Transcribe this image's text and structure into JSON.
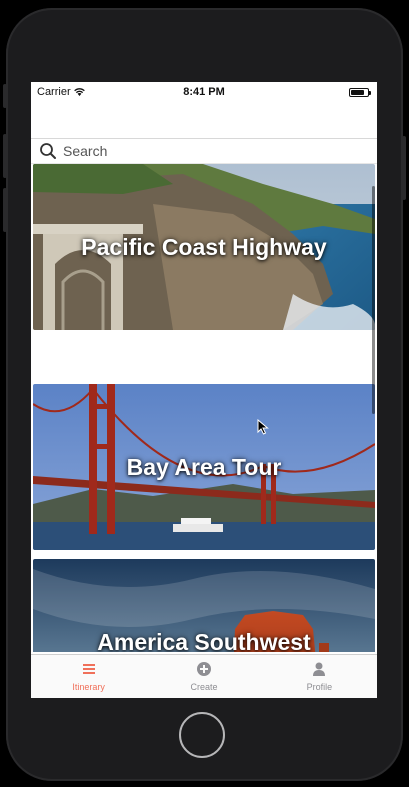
{
  "status_bar": {
    "carrier": "Carrier",
    "time": "8:41 PM",
    "battery_level": 0.8
  },
  "search": {
    "placeholder": "Search",
    "icon": "search-icon"
  },
  "cards": [
    {
      "title": "Pacific Coast Highway",
      "image": "coastal-bridge-photo"
    },
    {
      "title": "Bay Area Tour",
      "image": "golden-gate-bridge-photo"
    },
    {
      "title": "America Southwest",
      "image": "desert-butte-photo"
    }
  ],
  "tabs": [
    {
      "label": "Itinerary",
      "icon": "list-icon",
      "active": true
    },
    {
      "label": "Create",
      "icon": "plus-circle-icon",
      "active": false
    },
    {
      "label": "Profile",
      "icon": "person-icon",
      "active": false
    }
  ],
  "colors": {
    "accent": "#f0705a",
    "tab_inactive": "#8e8e93"
  }
}
